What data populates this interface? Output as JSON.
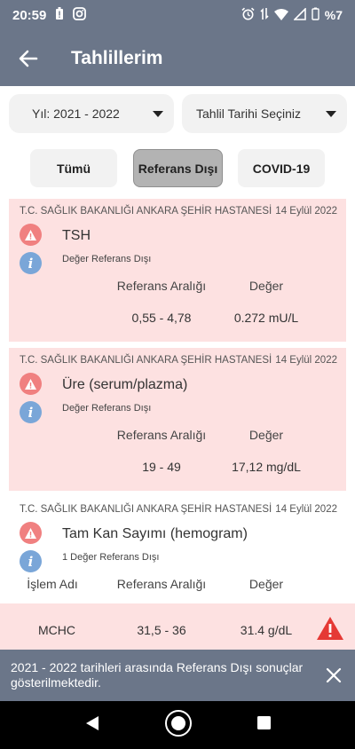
{
  "status_bar": {
    "time": "20:59",
    "battery": "%7"
  },
  "app_bar": {
    "title": "Tahlillerim"
  },
  "filters": {
    "year_dropdown": "Yıl: 2021 - 2022",
    "date_dropdown": "Tahlil Tarihi Seçiniz",
    "tabs": [
      "Tümü",
      "Referans Dışı",
      "COVID-19"
    ],
    "selected_tab": "Referans Dışı"
  },
  "labels": {
    "reference_range": "Referans Aralığı",
    "value": "Değer",
    "process_name": "İşlem Adı"
  },
  "results": [
    {
      "hospital": "T.C. SAĞLIK BAKANLIĞI ANKARA ŞEHİR HASTANESİ",
      "date": "14 Eylül 2022",
      "test": "TSH",
      "status": "Değer Referans Dışı",
      "range": "0,55 - 4,78",
      "value": "0.272 mU/L"
    },
    {
      "hospital": "T.C. SAĞLIK BAKANLIĞI ANKARA ŞEHİR HASTANESİ",
      "date": "14 Eylül 2022",
      "test": "Üre (serum/plazma)",
      "status": "Değer Referans Dışı",
      "range": "19 - 49",
      "value": "17,12 mg/dL"
    },
    {
      "hospital": "T.C. SAĞLIK BAKANLIĞI ANKARA ŞEHİR HASTANESİ",
      "date": "14 Eylül 2022",
      "test": "Tam Kan Sayımı (hemogram)",
      "status": "1 Değer Referans Dışı",
      "rows": [
        {
          "name": "MCHC",
          "range": "31,5 - 36",
          "value": "31.4 g/dL"
        }
      ]
    }
  ],
  "snackbar": {
    "message": "2021 - 2022 tarihleri arasında Referans Dışı sonuçlar gösterilmektedir."
  },
  "colors": {
    "header": "#6b7689",
    "out_of_range_bg": "#fde1e1",
    "warning": "#f08080",
    "info": "#7aa6d8",
    "alert_red": "#e53935"
  }
}
